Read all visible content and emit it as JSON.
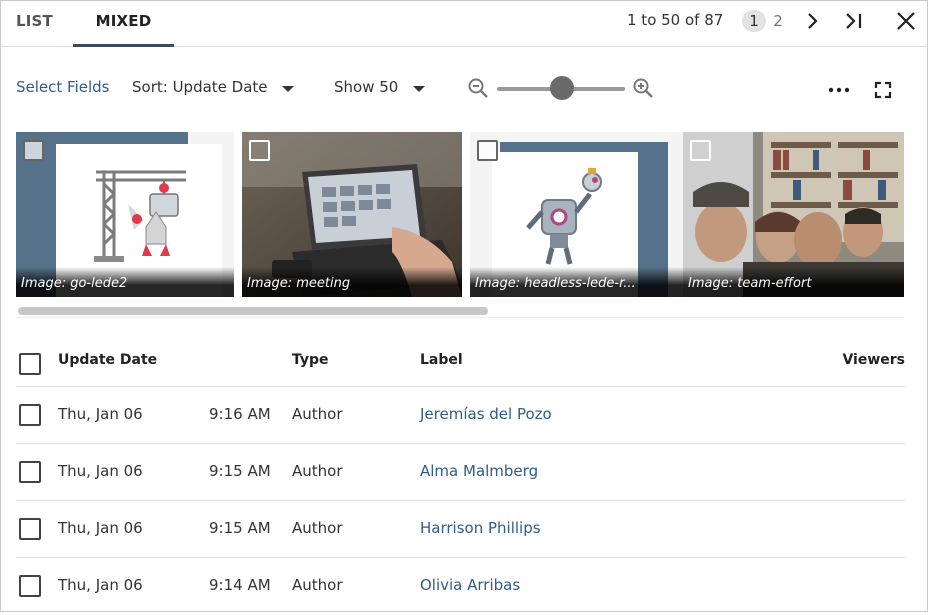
{
  "tabs": [
    {
      "label": "LIST",
      "active": false
    },
    {
      "label": "MIXED",
      "active": true
    }
  ],
  "pagination": {
    "range_text": "1 to 50 of 87",
    "pages": [
      "1",
      "2"
    ],
    "current_page": "1"
  },
  "toolbar": {
    "select_fields": "Select Fields",
    "sort_label": "Sort: Update Date",
    "show_label": "Show 50",
    "zoom_level": 0.5
  },
  "thumbnails": [
    {
      "caption": "Image: go-lede2",
      "scene": "crane-robot-illustration"
    },
    {
      "caption": "Image: meeting",
      "scene": "laptop-photo"
    },
    {
      "caption": "Image: headless-lede-r...",
      "scene": "robot-illustration"
    },
    {
      "caption": "Image: team-effort",
      "scene": "team-photo"
    }
  ],
  "table": {
    "headers": {
      "update_date": "Update Date",
      "type": "Type",
      "label": "Label",
      "viewers": "Viewers"
    },
    "rows": [
      {
        "date": "Thu, Jan 06",
        "time": "9:16 AM",
        "type": "Author",
        "label": "Jeremías del Pozo"
      },
      {
        "date": "Thu, Jan 06",
        "time": "9:15 AM",
        "type": "Author",
        "label": "Alma Malmberg"
      },
      {
        "date": "Thu, Jan 06",
        "time": "9:15 AM",
        "type": "Author",
        "label": "Harrison Phillips"
      },
      {
        "date": "Thu, Jan 06",
        "time": "9:14 AM",
        "type": "Author",
        "label": "Olivia Arribas"
      }
    ]
  },
  "colors": {
    "link": "#2e5d8a",
    "tab_underline": "#3b4a5c",
    "page_badge": "#e2e2e2"
  }
}
